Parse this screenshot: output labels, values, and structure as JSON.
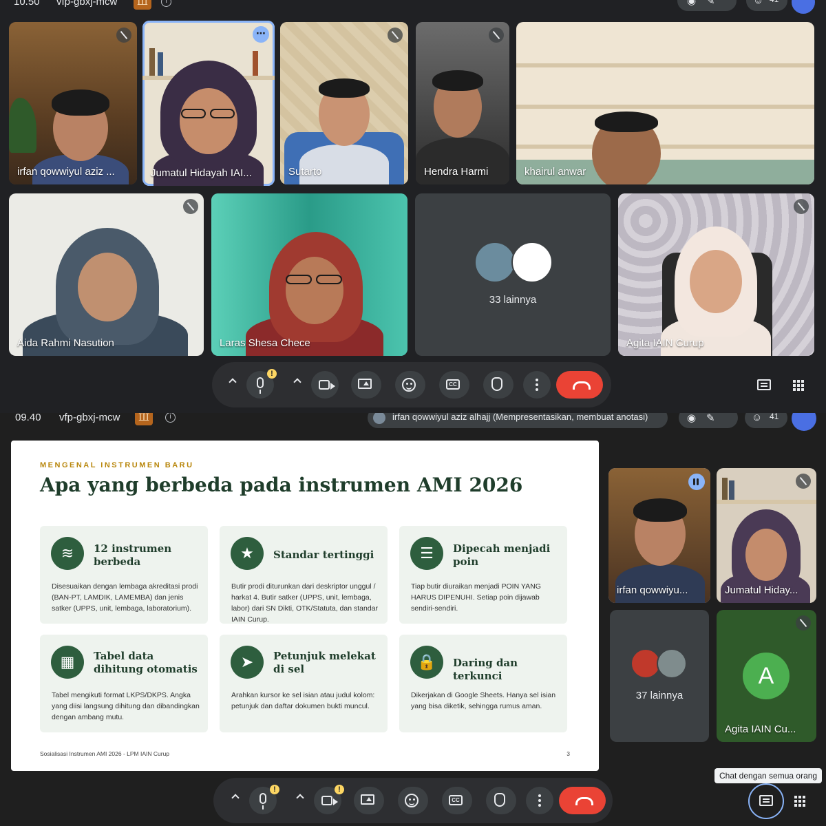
{
  "top_meeting": {
    "time": "10.50",
    "meeting_code": "vfp-gbxj-mcw",
    "host_badge": "Ш",
    "participant_count": "41",
    "tiles": [
      {
        "name": "irfan qowwiyul aziz ..."
      },
      {
        "name": "Jumatul Hidayah IAI..."
      },
      {
        "name": "Sutarto"
      },
      {
        "name": "Hendra Harmi"
      },
      {
        "name": "khairul anwar"
      },
      {
        "name": "Aida Rahmi Nasution"
      },
      {
        "name": "Laras Shesa Chece"
      },
      {
        "name": "33 lainnya"
      },
      {
        "name": "Agita IAIN Curup"
      }
    ]
  },
  "bottom_meeting": {
    "time": "09.40",
    "meeting_code": "vfp-gbxj-mcw",
    "host_badge": "Ш",
    "presenter_status": "irfan qowwiyul aziz alhajj (Mempresentasikan, membuat anotasi)",
    "participant_count": "41",
    "tiles": [
      {
        "name": "irfan qowwiyu..."
      },
      {
        "name": "Jumatul Hiday..."
      },
      {
        "name": "37 lainnya"
      },
      {
        "name": "Agita IAIN Cu...",
        "avatar_letter": "A"
      }
    ],
    "chat_tooltip": "Chat dengan semua orang"
  },
  "slide": {
    "eyebrow": "MENGENAL INSTRUMEN BARU",
    "title": "Apa yang berbeda pada instrumen AMI 2026",
    "cards": [
      {
        "icon": "layers-icon",
        "title": "12 instrumen berbeda",
        "body": "Disesuaikan dengan lembaga akreditasi prodi (BAN-PT, LAMDIK, LAMEMBA) dan jenis satker (UPPS, unit, lembaga, laboratorium)."
      },
      {
        "icon": "star-icon",
        "title": "Standar tertinggi",
        "body": "Butir prodi diturunkan dari deskriptor unggul / harkat 4. Butir satker (UPPS, unit, lembaga, labor) dari SN Dikti, OTK/Statuta, dan standar IAIN Curup."
      },
      {
        "icon": "list-icon",
        "title": "Dipecah menjadi poin",
        "body": "Tiap butir diuraikan menjadi POIN YANG HARUS DIPENUHI. Setiap poin dijawab sendiri-sendiri."
      },
      {
        "icon": "table-icon",
        "title": "Tabel data dihitung otomatis",
        "body": "Tabel mengikuti format LKPS/DKPS. Angka yang diisi langsung dihitung dan dibandingkan dengan ambang mutu."
      },
      {
        "icon": "cursor-icon",
        "title": "Petunjuk melekat di sel",
        "body": "Arahkan kursor ke sel isian atau judul kolom: petunjuk dan daftar dokumen bukti muncul."
      },
      {
        "icon": "lock-icon",
        "title": "Daring dan terkunci",
        "body": "Dikerjakan di Google Sheets. Hanya sel isian yang bisa diketik, sehingga rumus aman."
      }
    ],
    "footer": "Sosialisasi Instrumen AMI 2026 - LPM IAIN Curup",
    "page": "3"
  },
  "colors": {
    "accent_blue": "#8ab4f8",
    "end_call_red": "#ea4335",
    "slide_green": "#2e5e3e",
    "eyebrow_gold": "#b8860b"
  }
}
